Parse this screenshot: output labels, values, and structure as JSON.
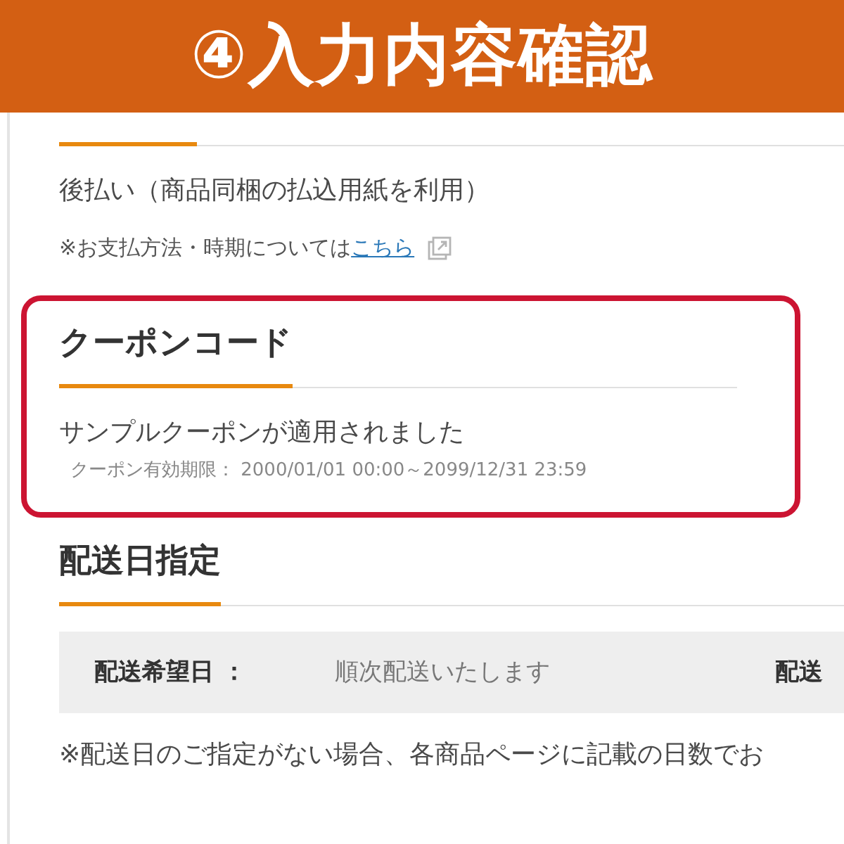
{
  "banner": {
    "title": "④入力内容確認"
  },
  "payment": {
    "method": "後払い（商品同梱の払込用紙を利用）",
    "note": "※お支払方法・時期については",
    "link": "こちら"
  },
  "coupon": {
    "highlighted": true,
    "heading": "クーポンコード",
    "status": "サンプルクーポンが適用されました",
    "validity": "クーポン有効期限： 2000/01/01 00:00～2099/12/31 23:59"
  },
  "delivery": {
    "heading": "配送日指定",
    "fields": [
      {
        "label": "配送希望日 ：",
        "value": "順次配送いたします"
      },
      {
        "label": "配送"
      }
    ],
    "note": "※配送日のご指定がない場合、各商品ページに記載の日数でお"
  }
}
